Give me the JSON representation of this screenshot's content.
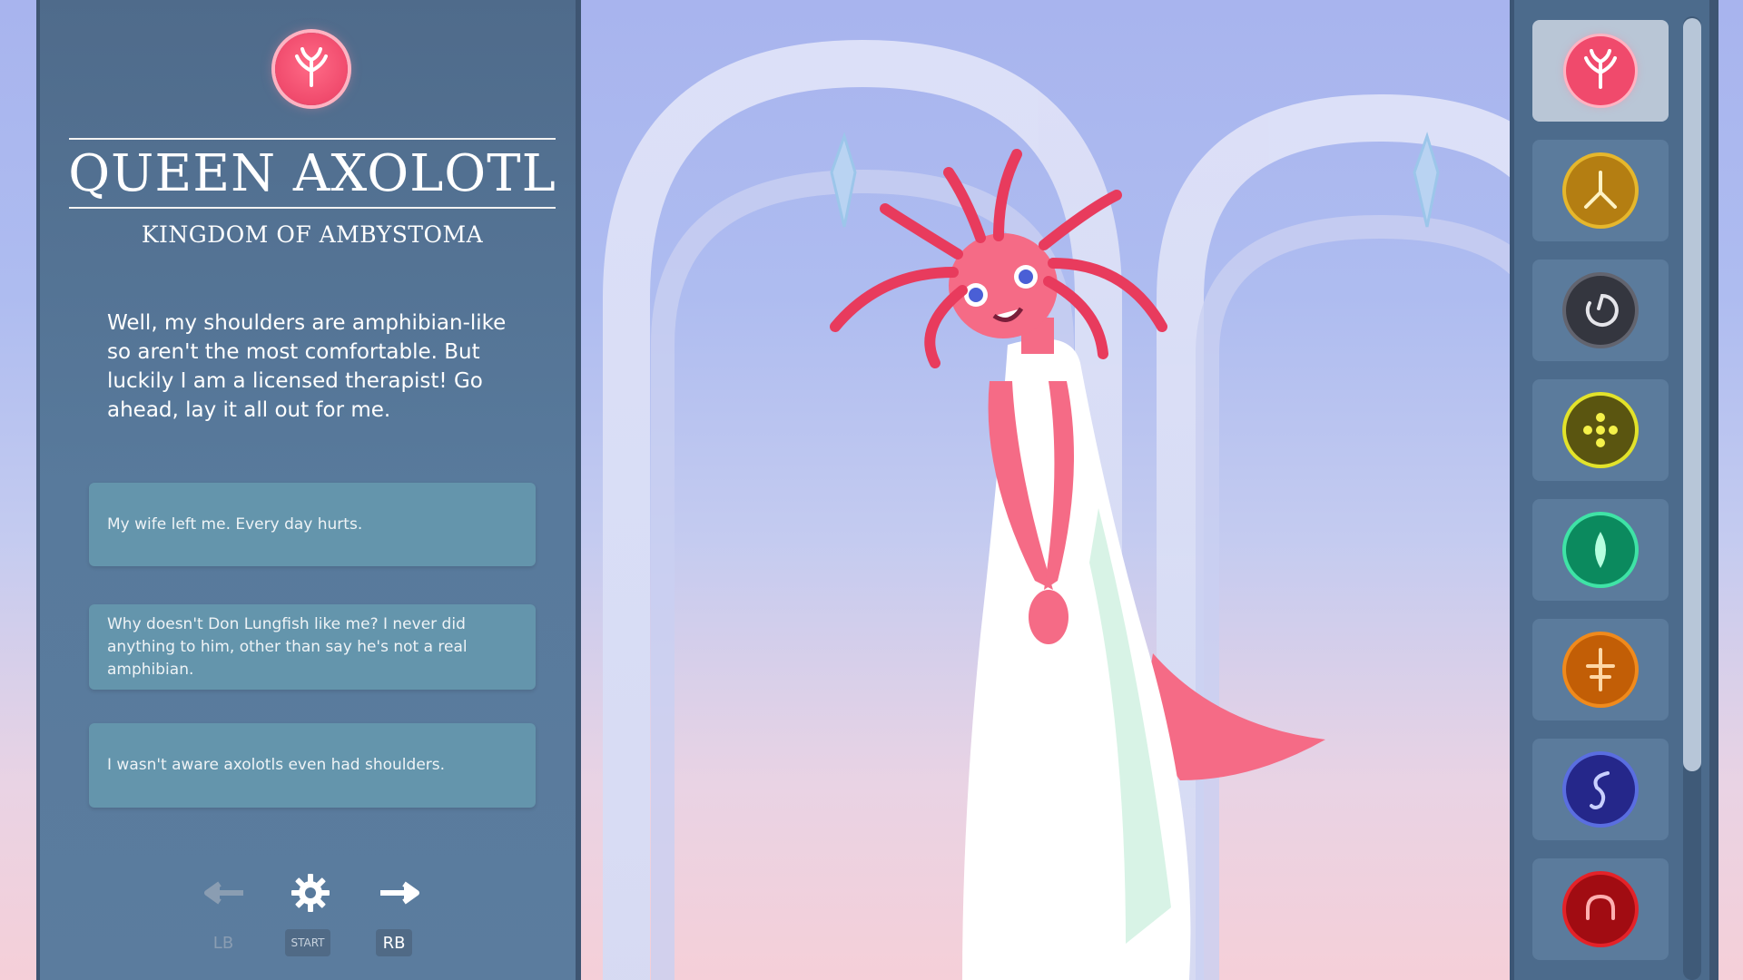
{
  "character": {
    "name": "QUEEN AXOLOTL",
    "kingdom": "KINGDOM OF AMBYSTOMA",
    "dialogue": "Well, my shoulders are amphibian-like so aren't the most comfortable. But luckily I am a licensed therapist! Go ahead, lay it all out for me.",
    "crest_color": "#f04a6c"
  },
  "choices": [
    {
      "text": "My wife left me. Every day hurts."
    },
    {
      "text": "Why doesn't Don Lungfish like me? I never did anything to him, other than say he's not a real amphibian."
    },
    {
      "text": "I wasn't aware axolotls even had shoulders."
    }
  ],
  "controls": {
    "prev_label": "LB",
    "settings_label": "START",
    "next_label": "RB"
  },
  "characters_list": [
    {
      "name": "axolotl-icon",
      "color": "#f04a6c",
      "active": true
    },
    {
      "name": "bird-foot-icon",
      "color": "#d9a31c",
      "active": false
    },
    {
      "name": "crescent-icon",
      "color": "#3c3f4a",
      "active": false
    },
    {
      "name": "dots-icon",
      "color": "#c8c81c",
      "active": false
    },
    {
      "name": "leaf-icon",
      "color": "#1fc08a",
      "active": false
    },
    {
      "name": "star-icon",
      "color": "#e07a12",
      "active": false
    },
    {
      "name": "serpent-icon",
      "color": "#3b3fb0",
      "active": false
    },
    {
      "name": "arch-icon",
      "color": "#c8181e",
      "active": false
    }
  ]
}
